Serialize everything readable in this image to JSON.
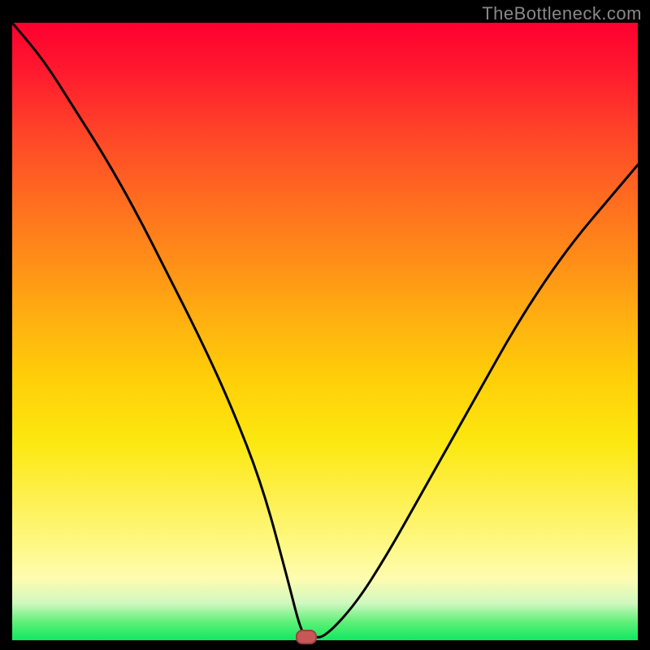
{
  "watermark": "TheBottleneck.com",
  "chart_data": {
    "type": "line",
    "title": "",
    "xlabel": "",
    "ylabel": "",
    "xlim": [
      0,
      100
    ],
    "ylim": [
      0,
      100
    ],
    "x": [
      0,
      5,
      10,
      15,
      20,
      25,
      30,
      35,
      40,
      44,
      46,
      47,
      48,
      50,
      55,
      60,
      65,
      70,
      75,
      80,
      85,
      90,
      95,
      100
    ],
    "values": [
      100,
      94,
      86,
      78,
      69,
      59,
      49,
      38,
      25,
      10,
      2,
      0.5,
      0.5,
      0.5,
      6,
      14,
      23,
      32,
      41,
      50,
      58,
      65,
      71,
      77
    ],
    "marker": {
      "x": 47,
      "y": 0.5
    },
    "gradient_stops": [
      {
        "pos": 0,
        "color": "#ff0030"
      },
      {
        "pos": 50,
        "color": "#ffd008"
      },
      {
        "pos": 90,
        "color": "#fefcb0"
      },
      {
        "pos": 100,
        "color": "#10e860"
      }
    ]
  }
}
